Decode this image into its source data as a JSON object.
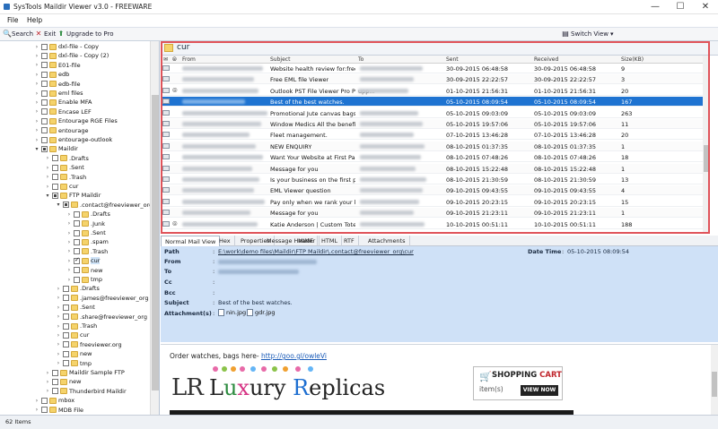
{
  "window": {
    "title": "SysTools Maildir Viewer v3.0 - FREEWARE",
    "minimize": "—",
    "maximize": "☐",
    "close": "✕"
  },
  "menu": {
    "file": "File",
    "help": "Help"
  },
  "toolbar": {
    "search": "Search",
    "exit": "Exit",
    "upgrade": "Upgrade to Pro",
    "switch_view": "Switch View"
  },
  "tree": [
    {
      "label": "dxl-file - Copy",
      "depth": 0
    },
    {
      "label": "dxl-file - Copy (2)",
      "depth": 0
    },
    {
      "label": "E01-file",
      "depth": 0
    },
    {
      "label": "edb",
      "depth": 0
    },
    {
      "label": "edb-file",
      "depth": 0
    },
    {
      "label": "eml files",
      "depth": 0
    },
    {
      "label": "Enable MFA",
      "depth": 0
    },
    {
      "label": "Encase LEF",
      "depth": 0
    },
    {
      "label": "Entourage RGE Files",
      "depth": 0
    },
    {
      "label": "entourage",
      "depth": 0
    },
    {
      "label": "entourage-outlook",
      "depth": 0
    },
    {
      "label": "Maildir",
      "depth": 0
    },
    {
      "label": ".Drafts",
      "depth": 1
    },
    {
      "label": ".Sent",
      "depth": 1
    },
    {
      "label": ".Trash",
      "depth": 1
    },
    {
      "label": "cur",
      "depth": 1
    },
    {
      "label": "FTP Maildir",
      "depth": 1
    },
    {
      "label": ".contact@freeviewer_org",
      "depth": 2
    },
    {
      "label": ".Drafts",
      "depth": 3
    },
    {
      "label": ".Junk",
      "depth": 3
    },
    {
      "label": ".Sent",
      "depth": 3
    },
    {
      "label": ".spam",
      "depth": 3
    },
    {
      "label": ".Trash",
      "depth": 3
    },
    {
      "label": "cur",
      "depth": 3
    },
    {
      "label": "new",
      "depth": 3
    },
    {
      "label": "tmp",
      "depth": 3
    },
    {
      "label": ".Drafts",
      "depth": 2
    },
    {
      "label": ".james@freeviewer_org",
      "depth": 2
    },
    {
      "label": ".Sent",
      "depth": 2
    },
    {
      "label": ".share@freeviewer_org",
      "depth": 2
    },
    {
      "label": ".Trash",
      "depth": 2
    },
    {
      "label": "cur",
      "depth": 2
    },
    {
      "label": "freeviewer.org",
      "depth": 2
    },
    {
      "label": "new",
      "depth": 2
    },
    {
      "label": "tmp",
      "depth": 2
    },
    {
      "label": "Maildir Sample FTP",
      "depth": 1
    },
    {
      "label": "new",
      "depth": 1
    },
    {
      "label": "Thunderbird Maildir",
      "depth": 1
    },
    {
      "label": "mbox",
      "depth": 0
    },
    {
      "label": "MDB File",
      "depth": 0
    }
  ],
  "folder": {
    "name": "cur"
  },
  "columns": {
    "from": "From",
    "subject": "Subject",
    "to": "To",
    "sent": "Sent",
    "received": "Received",
    "size": "Size(KB)"
  },
  "emails": [
    {
      "subject": "Website health review for:free...",
      "to": "",
      "sent": "30-09-2015 06:48:58",
      "received": "30-09-2015 06:48:58",
      "size": "9"
    },
    {
      "subject": "Free EML file Viewer",
      "to": "",
      "sent": "30-09-2015 22:22:57",
      "received": "30-09-2015 22:22:57",
      "size": "3"
    },
    {
      "subject": "Outlook PST File Viewer Pro Pl...",
      "to": "upp...",
      "sent": "01-10-2015 21:56:31",
      "received": "01-10-2015 21:56:31",
      "size": "20"
    },
    {
      "subject": "Best of the best watches.",
      "to": "",
      "sent": "05-10-2015 08:09:54",
      "received": "05-10-2015 08:09:54",
      "size": "167"
    },
    {
      "subject": "Promotional Jute canvas bags ...",
      "to": "",
      "sent": "05-10-2015 09:03:09",
      "received": "05-10-2015 09:03:09",
      "size": "263"
    },
    {
      "subject": "Window Medics All the benefit...",
      "to": "",
      "sent": "05-10-2015 19:57:06",
      "received": "05-10-2015 19:57:06",
      "size": "11"
    },
    {
      "subject": "Fleet management.",
      "to": "",
      "sent": "07-10-2015 13:46:28",
      "received": "07-10-2015 13:46:28",
      "size": "20"
    },
    {
      "subject": "NEW ENQUIRY",
      "to": "",
      "sent": "08-10-2015 01:37:35",
      "received": "08-10-2015 01:37:35",
      "size": "1"
    },
    {
      "subject": "Want Your Website at First Pag...",
      "to": "",
      "sent": "08-10-2015 07:48:26",
      "received": "08-10-2015 07:48:26",
      "size": "18"
    },
    {
      "subject": "Message for you",
      "to": "",
      "sent": "08-10-2015 15:22:48",
      "received": "08-10-2015 15:22:48",
      "size": "1"
    },
    {
      "subject": "Is your business on the first pa...",
      "to": "",
      "sent": "08-10-2015 21:30:59",
      "received": "08-10-2015 21:30:59",
      "size": "13"
    },
    {
      "subject": "EML Viewer question",
      "to": "",
      "sent": "09-10-2015 09:43:55",
      "received": "09-10-2015 09:43:55",
      "size": "4"
    },
    {
      "subject": "Pay only when we rank your ke...",
      "to": "",
      "sent": "09-10-2015 20:23:15",
      "received": "09-10-2015 20:23:15",
      "size": "15"
    },
    {
      "subject": "Message for you",
      "to": "",
      "sent": "09-10-2015 21:23:11",
      "received": "09-10-2015 21:23:11",
      "size": "1"
    },
    {
      "subject": "Katie Anderson | Custom  Tote ...",
      "to": "",
      "sent": "10-10-2015 00:51:11",
      "received": "10-10-2015 00:51:11",
      "size": "188"
    }
  ],
  "tabs": [
    "Normal Mail View",
    "Hex",
    "Properties",
    "Message Header",
    "MIME",
    "HTML",
    "RTF",
    "Attachments"
  ],
  "details": {
    "path_label": "Path",
    "path_value": "E:\\work\\demo files\\Maildir\\FTP Maildir\\.contact@freeviewer_org\\cur",
    "datetime_label": "Date Time",
    "datetime_value": "05-10-2015 08:09:54",
    "from_label": "From",
    "to_label": "To",
    "cc_label": "Cc",
    "bcc_label": "Bcc",
    "subject_label": "Subject",
    "subject_value": "Best of the best watches.",
    "attachments_label": "Attachment(s)",
    "attachments": [
      "nin.jpg",
      "gdr.jpg"
    ],
    "colon": ":"
  },
  "message": {
    "text": "Order watches, bags here- ",
    "link": "http://goo.gl/owleVi",
    "logo_lr": "LR",
    "logo_l": "L",
    "logo_u": "u",
    "logo_x": "x",
    "logo_ury": "ury",
    "logo_r": "R",
    "logo_eplicas": "eplicas",
    "cart_shopping": "SHOPPING ",
    "cart_cart": "CART",
    "cart_items": "item(s)",
    "cart_view": "VIEW NOW"
  },
  "status": {
    "items": "62 Items"
  },
  "colors": {
    "selection": "#1e73d1",
    "highlight_border": "#e0535a",
    "details_bg": "#cfe1f7"
  }
}
